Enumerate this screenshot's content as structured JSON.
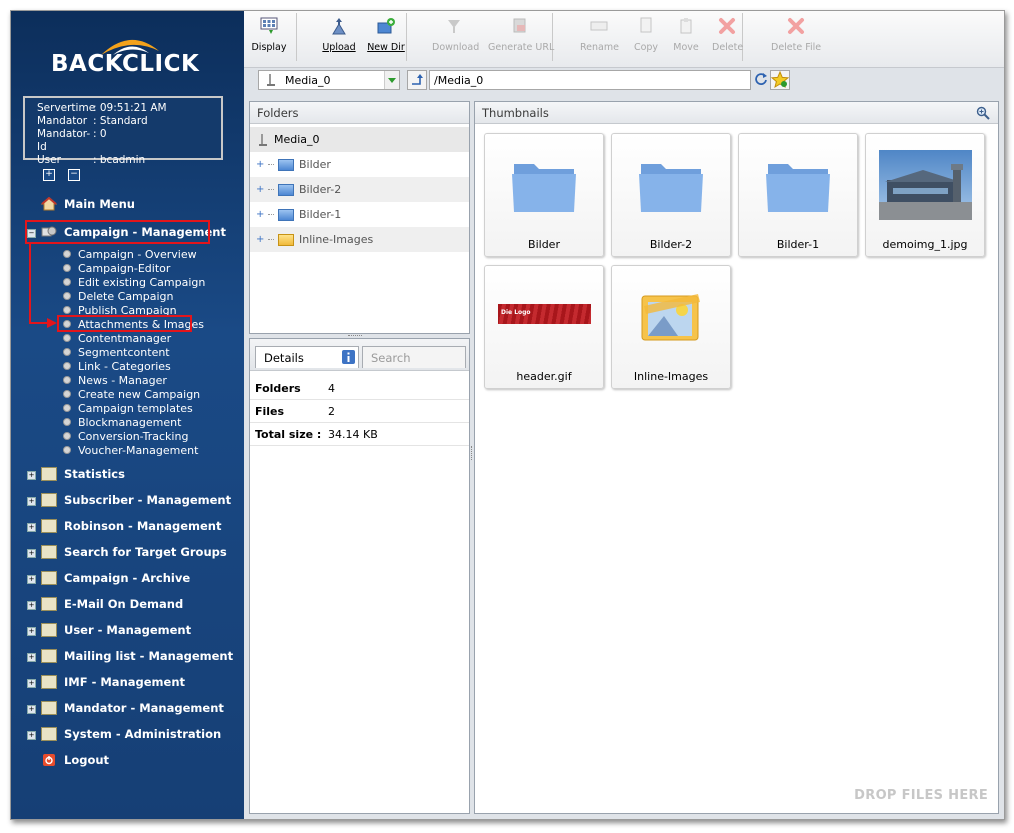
{
  "brand": {
    "logo_text": "BACKCLICK"
  },
  "session": {
    "servertime_label": "Servertime",
    "servertime": ": 09:51:21 AM",
    "mandator_label": "Mandator",
    "mandator": ": Standard",
    "mandator_id_label": "Mandator-Id",
    "mandator_id": ": 0",
    "user_label": "User",
    "user": ": bcadmin"
  },
  "sidebar": {
    "main_menu": "Main Menu",
    "campaign_management": "Campaign - Management",
    "campaign_items": [
      "Campaign - Overview",
      "Campaign-Editor",
      "Edit existing Campaign",
      "Delete Campaign",
      "Publish Campaign",
      "Attachments & Images",
      "Contentmanager",
      "Segmentcontent",
      "Link - Categories",
      "News - Manager",
      "Create new Campaign",
      "Campaign templates",
      "Blockmanagement",
      "Conversion-Tracking",
      "Voucher-Management"
    ],
    "sections": [
      "Statistics",
      "Subscriber - Management",
      "Robinson - Management",
      "Search for Target Groups",
      "Campaign - Archive",
      "E-Mail On Demand",
      "User - Management",
      "Mailing list - Management",
      "IMF - Management",
      "Mandator - Management",
      "System - Administration"
    ],
    "logout": "Logout"
  },
  "toolbar": {
    "display": "Display",
    "upload": "Upload",
    "new_dir": "New Dir",
    "download": "Download",
    "generate_url": "Generate URL",
    "rename": "Rename",
    "copy": "Copy",
    "move": "Move",
    "delete": "Delete",
    "delete_file": "Delete File"
  },
  "address": {
    "source": "Media_0",
    "path": "/Media_0"
  },
  "folders_panel": {
    "title": "Folders",
    "root": "Media_0",
    "items": [
      "Bilder",
      "Bilder-2",
      "Bilder-1",
      "Inline-Images"
    ]
  },
  "details_panel": {
    "tab_details": "Details",
    "tab_search": "Search",
    "rows": [
      {
        "label": "Folders",
        "value": "4"
      },
      {
        "label": "Files",
        "value": "2"
      },
      {
        "label": "Total size :",
        "value": "34.14 KB"
      }
    ]
  },
  "thumbnails_panel": {
    "title": "Thumbnails",
    "items": [
      "Bilder",
      "Bilder-2",
      "Bilder-1",
      "demoimg_1.jpg",
      "header.gif",
      "Inline-Images"
    ],
    "header_logo_text": "Die Logo",
    "drop_hint": "DROP FILES HERE"
  },
  "colors": {
    "sidebar_bg": "#1a4a86",
    "highlight": "#e3151b",
    "folder_blue": "#4d87d3"
  }
}
